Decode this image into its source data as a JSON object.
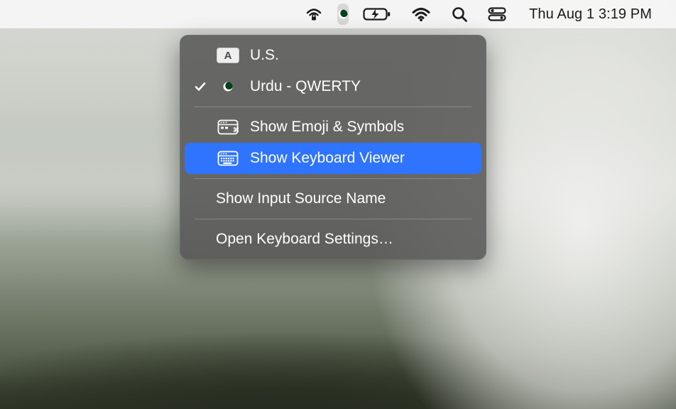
{
  "menubar": {
    "clock": "Thu Aug 1  3:19 PM"
  },
  "input_menu": {
    "sources": [
      {
        "label": "U.S.",
        "selected": false,
        "icon": "kb-a-badge"
      },
      {
        "label": "Urdu - QWERTY",
        "selected": true,
        "icon": "flag-pk"
      }
    ],
    "tools": [
      {
        "label": "Show Emoji & Symbols",
        "icon": "character-viewer",
        "highlighted": false
      },
      {
        "label": "Show Keyboard Viewer",
        "icon": "keyboard-viewer",
        "highlighted": true
      }
    ],
    "show_input_source_name": "Show Input Source Name",
    "open_settings": "Open Keyboard Settings…"
  }
}
